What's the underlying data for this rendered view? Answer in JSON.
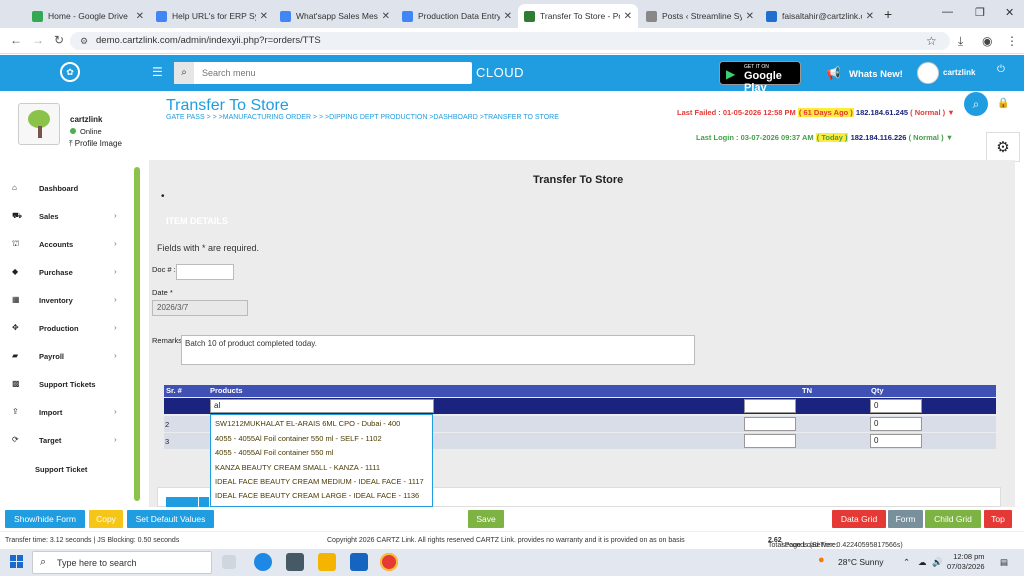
{
  "browser": {
    "tabs": [
      {
        "title": "Home - Google Drive",
        "color": "#34a853"
      },
      {
        "title": "Help URL's for ERP System",
        "color": "#4285f4"
      },
      {
        "title": "What'sapp Sales Message",
        "color": "#4285f4"
      },
      {
        "title": "Production Data Entry",
        "color": "#4285f4"
      },
      {
        "title": "Transfer To Store - Power",
        "color": "#2e7d32"
      },
      {
        "title": "Posts ‹ Streamline System",
        "color": "#555555"
      },
      {
        "title": "faisaltahir@cartzlink.com",
        "color": "#1f6fd1"
      }
    ],
    "url": "demo.cartzlink.com/admin/indexyii.php?r=orders/TTS"
  },
  "header": {
    "search_placeholder": "Search menu",
    "cloud_label": "CLOUD",
    "gplay_small": "GET IT ON",
    "gplay_big": "Google Play",
    "whats_new": "Whats New!",
    "username": "cartzlink"
  },
  "sidebar": {
    "profile_name": "cartzlink",
    "status": "Online",
    "profile_image_link": "Profile Image",
    "items": [
      {
        "label": "Dashboard",
        "icon": "home-icon",
        "glyph": "⌂",
        "chevron": false
      },
      {
        "label": "Sales",
        "icon": "cart-icon",
        "glyph": "⛟",
        "chevron": true
      },
      {
        "label": "Accounts",
        "icon": "bank-icon",
        "glyph": "⛫",
        "chevron": true
      },
      {
        "label": "Purchase",
        "icon": "tag-icon",
        "glyph": "◆",
        "chevron": true
      },
      {
        "label": "Inventory",
        "icon": "grid-icon",
        "glyph": "▦",
        "chevron": true
      },
      {
        "label": "Production",
        "icon": "gears-icon",
        "glyph": "✥",
        "chevron": true
      },
      {
        "label": "Payroll",
        "icon": "money-icon",
        "glyph": "▰",
        "chevron": true
      },
      {
        "label": "Support Tickets",
        "icon": "ticket-icon",
        "glyph": "▩",
        "chevron": false
      },
      {
        "label": "Import",
        "icon": "upload-icon",
        "glyph": "⇪",
        "chevron": true
      },
      {
        "label": "Target",
        "icon": "sync-icon",
        "glyph": "⟳",
        "chevron": true
      },
      {
        "label": "Support Ticket",
        "icon": "",
        "glyph": "",
        "chevron": false
      }
    ]
  },
  "page": {
    "title": "Transfer To Store",
    "breadcrumb": "GATE PASS  > > >MANUFACTURING ORDER  > > >DIPPING DEPT PRODUCTION  >DASHBOARD  >TRANSFER TO STORE",
    "last_failed_label": "Last Failed : 01-05-2026 12:58 PM",
    "last_failed_ago": "( 61 Days Ago )",
    "last_failed_ip": "182.184.61.245",
    "last_failed_status": "( Normal )",
    "last_login_label": "Last Login : 03-07-2026 09:37 AM",
    "last_login_ago": "( Today )",
    "last_login_ip": "182.184.116.226",
    "last_login_status": "( Normal )"
  },
  "form": {
    "title": "Transfer To Store",
    "section": "ITEM DETAILS",
    "required_note": "Fields with * are required.",
    "doc_label": "Doc # :",
    "doc_value": "",
    "date_label": "Date *",
    "date_value": "2026/3/7",
    "remarks_label": "Remarks",
    "remarks_value": "Batch 10 of product completed today."
  },
  "grid": {
    "headers": {
      "sr": "Sr. #",
      "products": "Products",
      "tn": "TN",
      "qty": "Qty"
    },
    "rows": [
      {
        "sr": "",
        "product": "al",
        "tn": "",
        "qty": "0"
      },
      {
        "sr": "2",
        "product": "",
        "tn": "",
        "qty": "0"
      },
      {
        "sr": "3",
        "product": "",
        "tn": "",
        "qty": "0"
      }
    ],
    "dropdown": [
      "SW1212MUKHALAT EL-ARAIS 6ML CPO - Dubai - 400",
      "4055 - 4055Al Foil container 550 ml - SELF - 1102",
      "4055 - 4055Al Foil container 550 ml",
      "KANZA BEAUTY CREAM SMALL - KANZA - 1111",
      "IDEAL FACE BEAUTY CREAM MEDIUM - IDEAL FACE - 1117",
      "IDEAL FACE BEAUTY CREAM LARGE - IDEAL FACE - 1136"
    ]
  },
  "toolbar": {
    "show_hide": "Show/hide Form",
    "copy": "Copy",
    "set_default": "Set Default Values",
    "save": "Save",
    "data_grid": "Data Grid",
    "form": "Form",
    "child_grid": "Child Grid",
    "top": "Top"
  },
  "footer": {
    "transfer": "Transfer time: 3.12 seconds  | JS Blocking: 0.50 seconds",
    "copyright": "Copyright 2026 CARTZ Link. All rights reserved CARTZ Link. provides no warranty and it is provided on as on basis",
    "load_prefix": "Total Page Load Time:",
    "load_value": "2.62",
    "load_suffix": "seconds (Server: 0.42240595817566s)"
  },
  "taskbar": {
    "search": "Type here to search",
    "weather": "28°C  Sunny",
    "time": "12:08 pm",
    "date": "07/03/2026"
  }
}
